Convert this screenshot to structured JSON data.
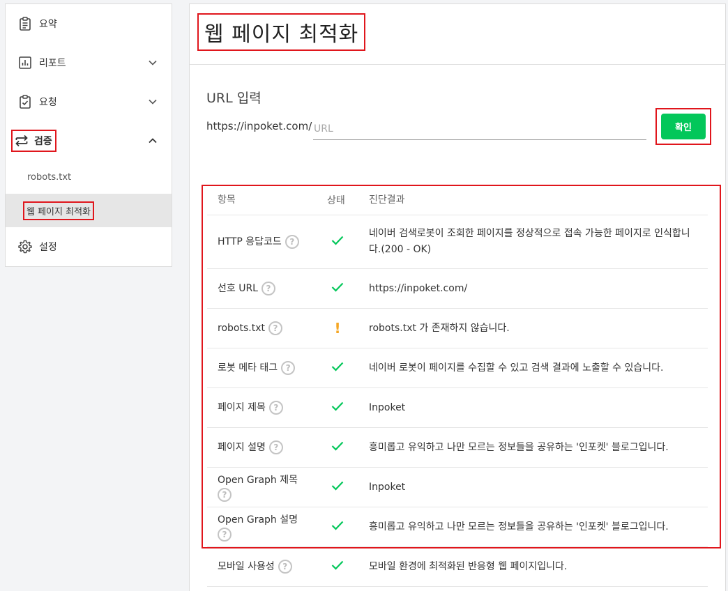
{
  "sidebar": {
    "items": [
      {
        "label": "요약",
        "icon": "clipboard-icon"
      },
      {
        "label": "리포트",
        "icon": "report-chart-icon"
      },
      {
        "label": "요청",
        "icon": "clipboard-check-icon"
      },
      {
        "label": "검증",
        "icon": "swap-arrows-icon"
      },
      {
        "label": "설정",
        "icon": "gear-icon"
      }
    ],
    "sub_items": [
      {
        "label": "robots.txt"
      },
      {
        "label": "웹 페이지 최적화"
      }
    ]
  },
  "page": {
    "title": "웹 페이지 최적화",
    "url_label": "URL 입력",
    "url_prefix": "https://inpoket.com/",
    "url_placeholder": "URL",
    "url_value": "",
    "confirm_label": "확인"
  },
  "table": {
    "headers": [
      "항목",
      "상태",
      "진단결과"
    ],
    "rows": [
      {
        "item": "HTTP 응답코드",
        "status": "ok",
        "result": "네이버 검색로봇이 조회한 페이지를 정상적으로 접속 가능한 페이지로 인식합니다.(200 - OK)"
      },
      {
        "item": "선호 URL",
        "status": "ok",
        "result": "https://inpoket.com/"
      },
      {
        "item": "robots.txt",
        "status": "warning",
        "result": "robots.txt 가 존재하지 않습니다."
      },
      {
        "item": "로봇 메타 태그",
        "status": "ok",
        "result": "네이버 로봇이 페이지를 수집할 수 있고 검색 결과에 노출할 수 있습니다."
      },
      {
        "item": "페이지 제목",
        "status": "ok",
        "result": "Inpoket"
      },
      {
        "item": "페이지 설명",
        "status": "ok",
        "result": "흥미롭고 유익하고 나만 모르는 정보들을 공유하는 '인포켓' 블로그입니다."
      },
      {
        "item": "Open Graph 제목",
        "status": "ok",
        "result": "Inpoket"
      },
      {
        "item": "Open Graph 설명",
        "status": "ok",
        "result": "흥미롭고 유익하고 나만 모르는 정보들을 공유하는 '인포켓' 블로그입니다."
      },
      {
        "item": "모바일 사용성",
        "status": "ok",
        "result": "모바일 환경에 최적화된 반응형 웹 페이지입니다."
      }
    ]
  },
  "colors": {
    "accent_green": "#03c75a",
    "warning_orange": "#f5a623",
    "highlight_red": "#e0161c"
  }
}
